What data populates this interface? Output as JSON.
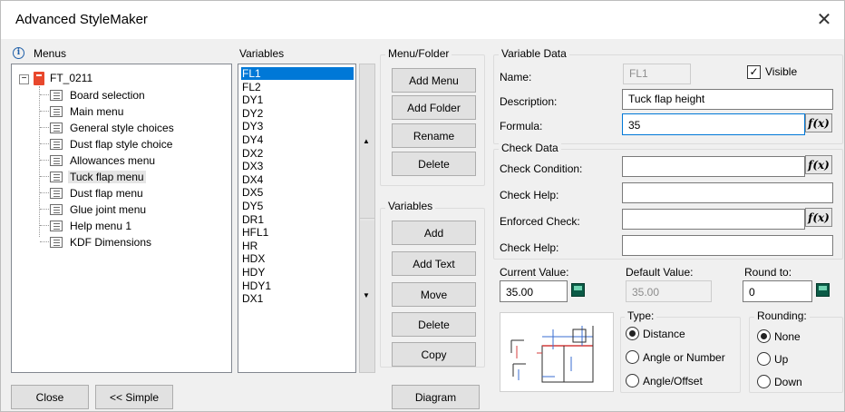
{
  "window": {
    "title": "Advanced StyleMaker",
    "close_glyph": "✕"
  },
  "menus_panel": {
    "header": "Menus",
    "root": "FT_0211",
    "root_expand": "−",
    "items": [
      "Board selection",
      "Main menu",
      "General style choices",
      "Dust flap style choice",
      "Allowances menu",
      "Tuck flap menu",
      "Dust flap menu",
      "Glue joint menu",
      "Help menu 1",
      "KDF Dimensions"
    ],
    "selected": "Tuck flap menu"
  },
  "variables_panel": {
    "header": "Variables",
    "items": [
      "FL1",
      "FL2",
      "DY1",
      "DY2",
      "DY3",
      "DY4",
      "DX2",
      "DX3",
      "DX4",
      "DX5",
      "DY5",
      "DR1",
      "HFL1",
      "HR",
      "HDX",
      "HDY",
      "HDY1",
      "DX1"
    ],
    "selected": "FL1",
    "scroll_up_glyph": "▲",
    "scroll_down_glyph": "▼"
  },
  "menu_folder": {
    "title": "Menu/Folder",
    "add_menu": "Add Menu",
    "add_folder": "Add Folder",
    "rename": "Rename",
    "delete": "Delete"
  },
  "variables_group": {
    "title": "Variables",
    "add": "Add",
    "add_text": "Add Text",
    "move": "Move",
    "delete": "Delete",
    "copy": "Copy"
  },
  "variable_data": {
    "title": "Variable Data",
    "name_label": "Name:",
    "name_value": "FL1",
    "visible_label": "Visible",
    "visible_mark": "✓",
    "description_label": "Description:",
    "description_value": "Tuck flap height",
    "formula_label": "Formula:",
    "formula_value": "35",
    "fx": "f(x)"
  },
  "check_data": {
    "title": "Check Data",
    "check_condition_label": "Check Condition:",
    "check_help_label": "Check Help:",
    "enforced_check_label": "Enforced Check:",
    "check_help2_label": "Check Help:",
    "fx": "f(x)"
  },
  "values": {
    "current_label": "Current Value:",
    "current_value": "35.00",
    "default_label": "Default Value:",
    "default_value": "35.00",
    "round_label": "Round to:",
    "round_value": "0"
  },
  "type_group": {
    "title": "Type:",
    "options": [
      "Distance",
      "Angle or Number",
      "Angle/Offset"
    ],
    "selected": "Distance"
  },
  "rounding_group": {
    "title": "Rounding:",
    "options": [
      "None",
      "Up",
      "Down"
    ],
    "selected": "None"
  },
  "footer": {
    "close": "Close",
    "simple": "<< Simple",
    "diagram": "Diagram"
  },
  "colors": {
    "selection": "#0078d7",
    "root_icon": "#e8482d",
    "window_bg": "#f0f0f0"
  }
}
